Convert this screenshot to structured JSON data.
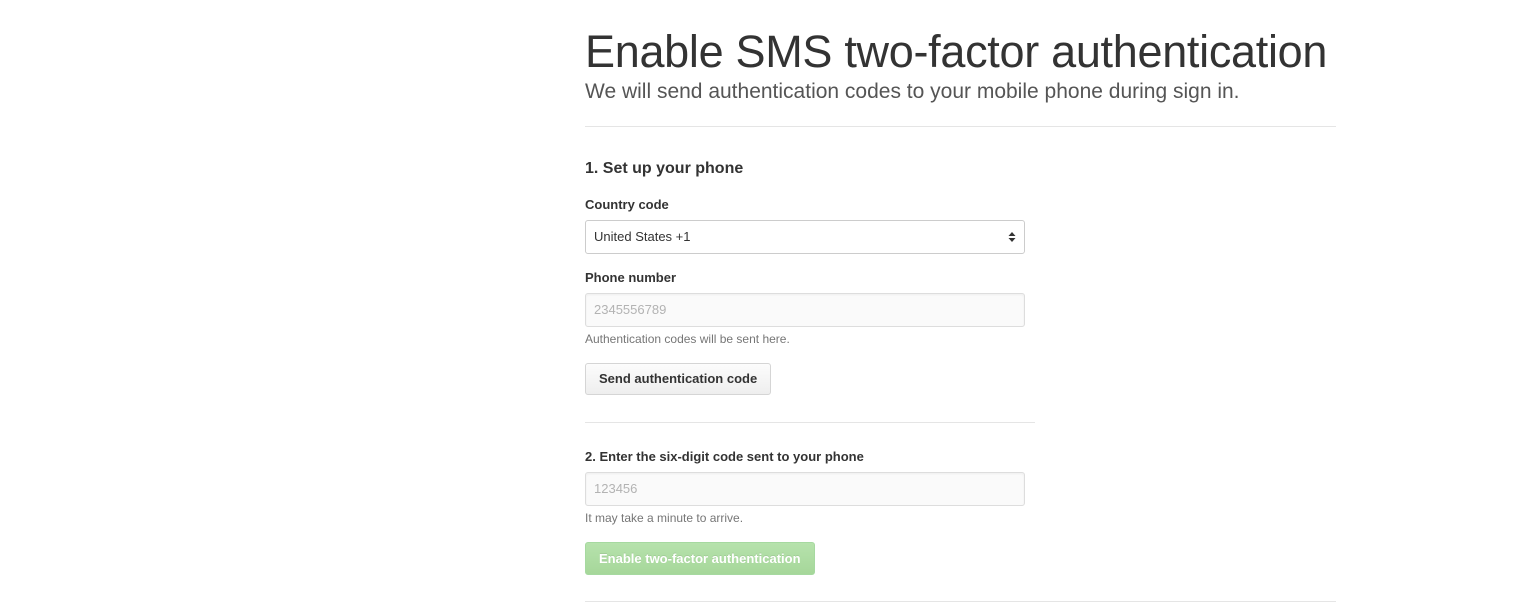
{
  "header": {
    "title": "Enable SMS two-factor authentication",
    "subtitle": "We will send authentication codes to your mobile phone during sign in."
  },
  "step1": {
    "heading": "1. Set up your phone",
    "country_label": "Country code",
    "country_value": "United States +1",
    "phone_label": "Phone number",
    "phone_placeholder": "2345556789",
    "phone_hint": "Authentication codes will be sent here.",
    "send_button": "Send authentication code"
  },
  "step2": {
    "heading": "2. Enter the six-digit code sent to your phone",
    "code_placeholder": "123456",
    "code_hint": "It may take a minute to arrive.",
    "enable_button": "Enable two-factor authentication"
  },
  "colors": {
    "enable_button_bg": "#a6d79a",
    "rule": "#e5e5e5"
  },
  "icons": {
    "select_arrows": "select-updown-icon"
  }
}
